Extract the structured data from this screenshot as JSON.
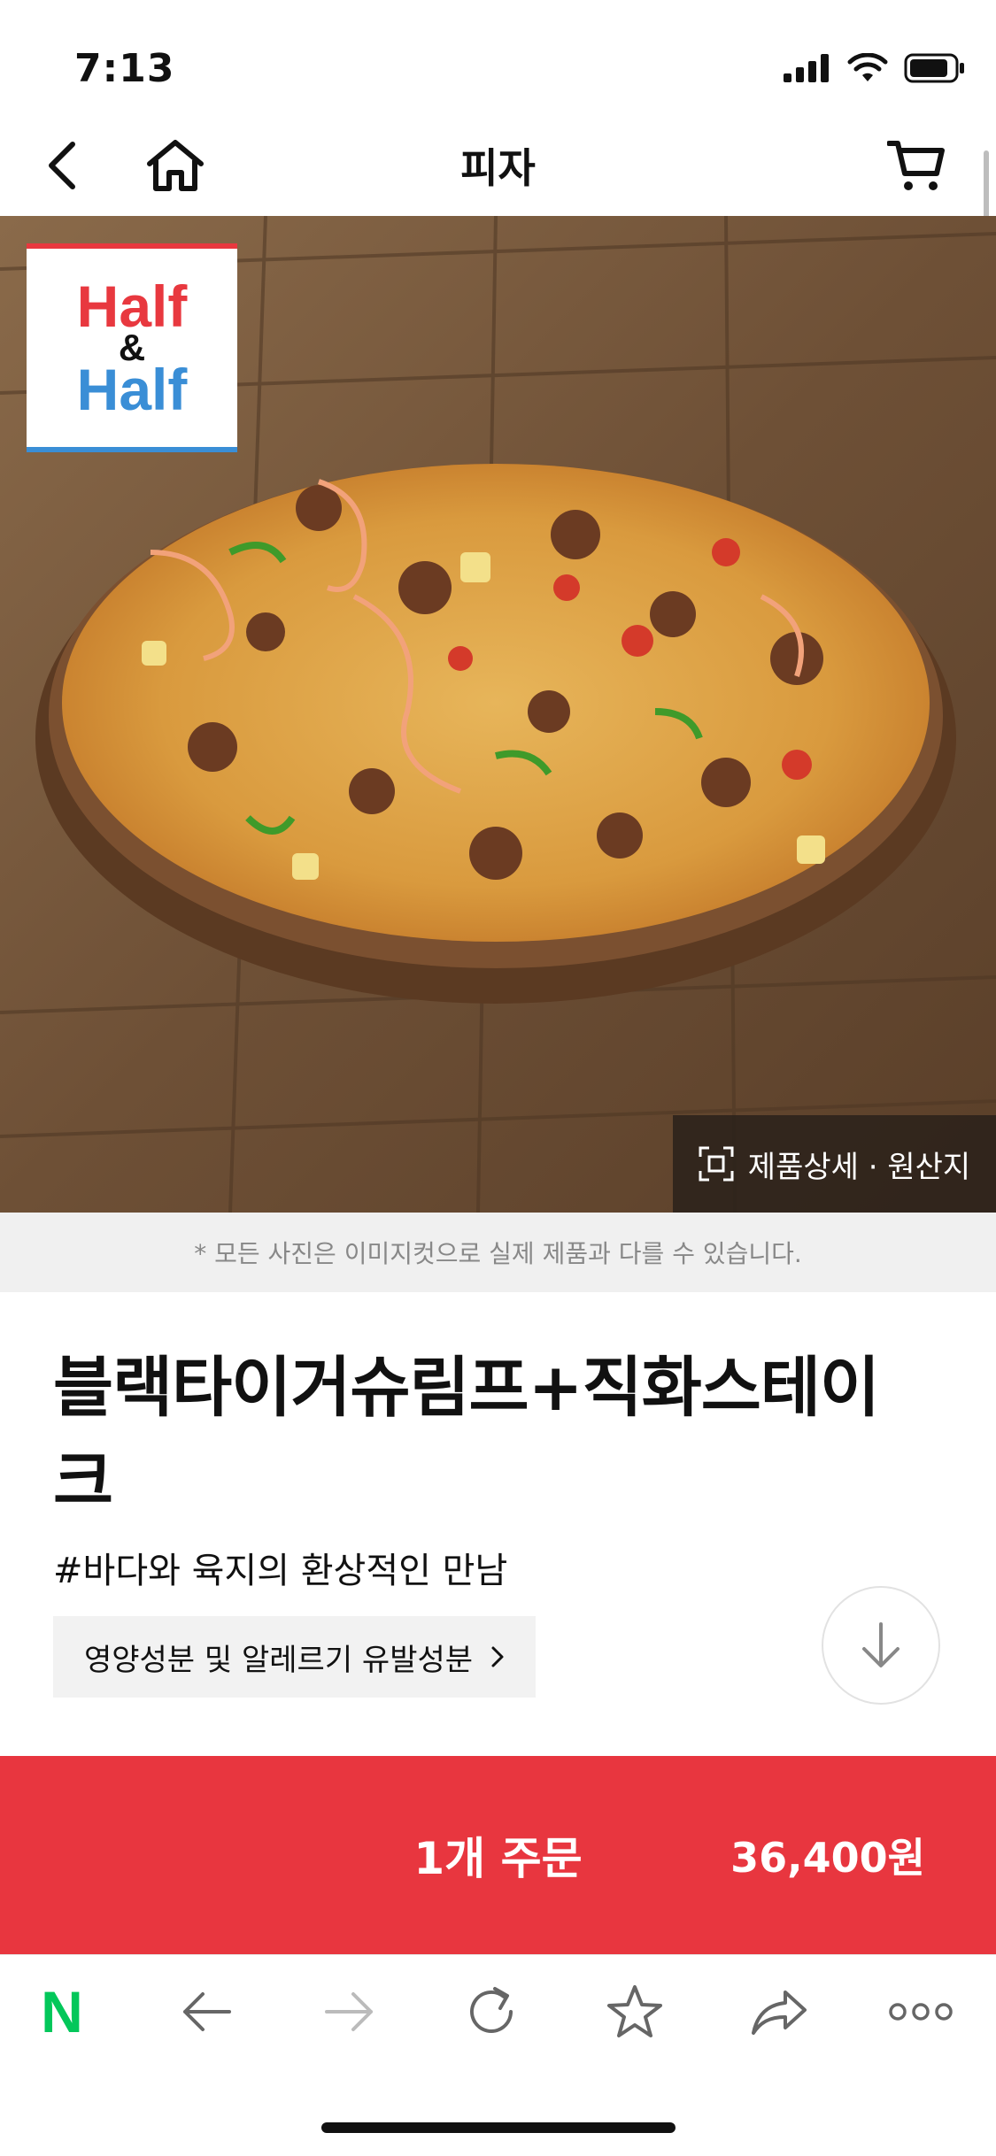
{
  "status_bar": {
    "time": "7:13"
  },
  "nav": {
    "title": "피자"
  },
  "hero": {
    "badge_line1": "Half",
    "badge_line2": "&",
    "badge_line3": "Half",
    "detail_button_label": "제품상세 · 원산지"
  },
  "photo_note": "* 모든 사진은 이미지컷으로 실제 제품과 다를 수 있습니다.",
  "product": {
    "title": "블랙타이거슈림프+직화스테이크",
    "tagline": "#바다와 육지의 환상적인 만남",
    "allergen_label": "영양성분 및 알레르기 유발성분"
  },
  "order": {
    "label": "1개 주문",
    "price": "36,400원"
  },
  "browser_bar": {
    "naver_logo": "N"
  },
  "colors": {
    "accent": "#e8363f",
    "badge_red": "#e8383f",
    "badge_blue": "#3a8ed6",
    "naver_green": "#03c75a"
  }
}
